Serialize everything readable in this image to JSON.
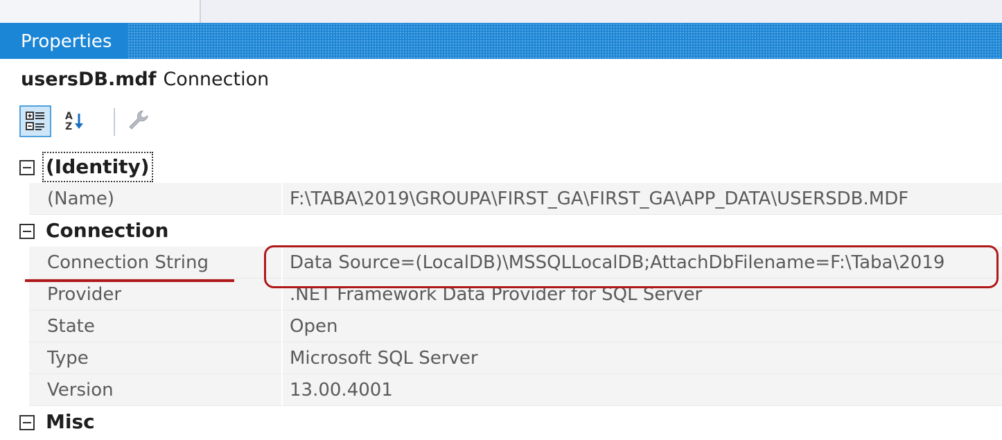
{
  "panel": {
    "title": "Properties"
  },
  "object": {
    "name": "usersDB.mdf",
    "type": "Connection"
  },
  "toolbar": {
    "categorized_icon": "categorized-icon",
    "alphabetical_icon": "alphabetical-sort-icon",
    "property_pages_icon": "wrench-icon"
  },
  "categories": [
    {
      "label": "(Identity)",
      "properties": [
        {
          "name": "(Name)",
          "value": "F:\\TABA\\2019\\GROUPA\\FIRST_GA\\FIRST_GA\\APP_DATA\\USERSDB.MDF"
        }
      ]
    },
    {
      "label": "Connection",
      "properties": [
        {
          "name": "Connection String",
          "value": "Data Source=(LocalDB)\\MSSQLLocalDB;AttachDbFilename=F:\\Taba\\2019"
        },
        {
          "name": "Provider",
          "value": ".NET Framework Data Provider for SQL Server"
        },
        {
          "name": "State",
          "value": "Open"
        },
        {
          "name": "Type",
          "value": "Microsoft SQL Server"
        },
        {
          "name": "Version",
          "value": "13.00.4001"
        }
      ]
    },
    {
      "label": "Misc",
      "properties": []
    }
  ],
  "colors": {
    "titlebar": "#1c86d6",
    "annotation": "#b01818"
  }
}
